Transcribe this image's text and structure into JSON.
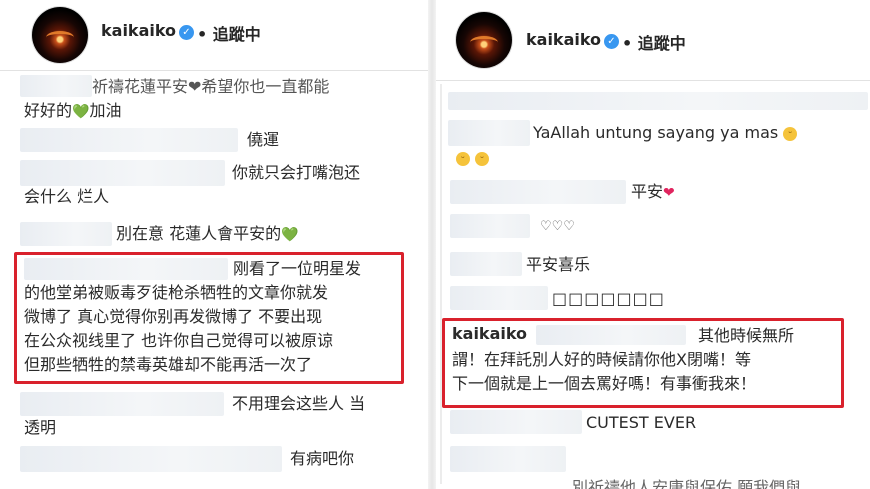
{
  "left": {
    "username": "kaikaiko",
    "follow": "• 追蹤中",
    "comments": [
      {
        "line1": "祈禱花蓮平安❤希望你也一直都能",
        "line2": "好好的",
        "heart": "💚",
        "tail": "加油"
      },
      {
        "text": "僥運"
      },
      {
        "line1": "你就只会打嘴泡还",
        "line2": "会什么 烂人"
      },
      {
        "text": "別在意 花蓮人會平安的",
        "heart": "💚"
      },
      {
        "lines": [
          "刚看了一位明星发",
          "的他堂弟被贩毒歹徒枪杀牺牲的文章你就发",
          "微博了 真心觉得你别再发微博了 不要出现",
          "在公众视线里了 也许你自己觉得可以被原谅",
          "但那些牺牲的禁毒英雄却不能再活一次了"
        ]
      },
      {
        "line1": "不用理会这些人 当",
        "line2": "透明"
      },
      {
        "text": "有病吧你"
      }
    ]
  },
  "right": {
    "username": "kaikaiko",
    "follow": "• 追蹤中",
    "comments": [
      {
        "text": "YaAllah untung sayang ya mas"
      },
      {
        "text": "平安",
        "heart": "❤"
      },
      {
        "text": "♡♡♡"
      },
      {
        "text": "平安喜乐"
      },
      {
        "text": "□□□□□□□"
      },
      {
        "user": "kaikaiko",
        "line1": "其他時候無所",
        "line2": "謂！在拜託別人好的時候請你他X閉嘴！等",
        "line3": "下一個就是上一個去罵好嗎！有事衝我來！"
      },
      {
        "text": "CUTEST EVER"
      },
      {
        "text": "別祈禱他人安康與保佑 願我們與"
      }
    ]
  },
  "colors": {
    "highlight": "#d9212c",
    "verified": "#3897f0",
    "heart": "#e0245e",
    "green_heart": "#2fb24c"
  },
  "icons": [
    "verified-badge-icon",
    "heart-icon",
    "green-heart-icon",
    "smile-emoji-icon"
  ]
}
